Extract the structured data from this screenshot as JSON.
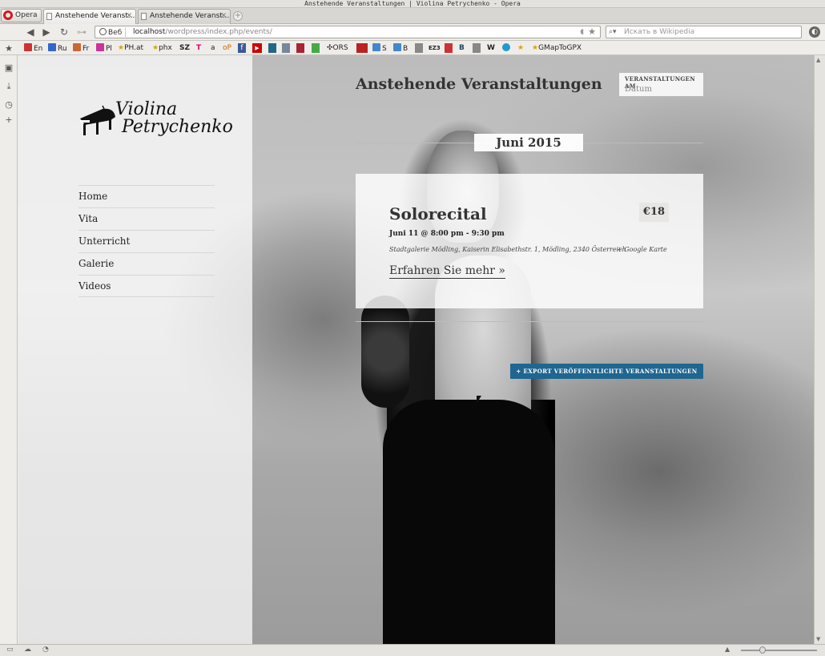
{
  "window": {
    "title": "Anstehende Veranstaltungen | Violina Petrychenko - Opera"
  },
  "tabs": {
    "opera_label": "Opera",
    "items": [
      {
        "label": "Anstehende Veranst...",
        "active": true
      },
      {
        "label": "Anstehende Veranst...",
        "active": false
      }
    ]
  },
  "address": {
    "badge": "Веб",
    "url_host": "localhost",
    "url_path": "/wordpress/index.php/events/",
    "search_placeholder": "Искать в Wikipedia"
  },
  "bookmarks": [
    "En",
    "Ru",
    "Fr",
    "Pl",
    "PH.at",
    "phx",
    "SZ",
    "T",
    "a",
    "oP",
    "f",
    "▶",
    "ORS",
    "S",
    "B",
    "EZ3",
    "W",
    "GMapToGPX"
  ],
  "site": {
    "logo_line1": "Violina",
    "logo_line2": "Petrychenko",
    "nav": [
      "Home",
      "Vita",
      "Unterricht",
      "Galerie",
      "Videos"
    ]
  },
  "events": {
    "page_title": "Anstehende Veranstaltungen",
    "date_filter_label": "VERANSTALTUNGEN AM",
    "date_filter_value": "Datum",
    "month": "Juni 2015",
    "event_name": "Solorecital",
    "event_price": "€18",
    "event_when": "Juni 11 @ 8:00 pm - 9:30 pm",
    "event_venue": "Stadtgalerie Mödling, Kaiserin Elisabethstr. 1, Mödling, 2340 Österreich",
    "event_map": "+ Google Karte",
    "event_more": "Erfahren Sie mehr »",
    "export_label": "+ EXPORT VERÖFFENTLICHTE VERANSTALTUNGEN"
  },
  "colors": {
    "accent": "#1f6690",
    "opera_red": "#d01b20"
  }
}
